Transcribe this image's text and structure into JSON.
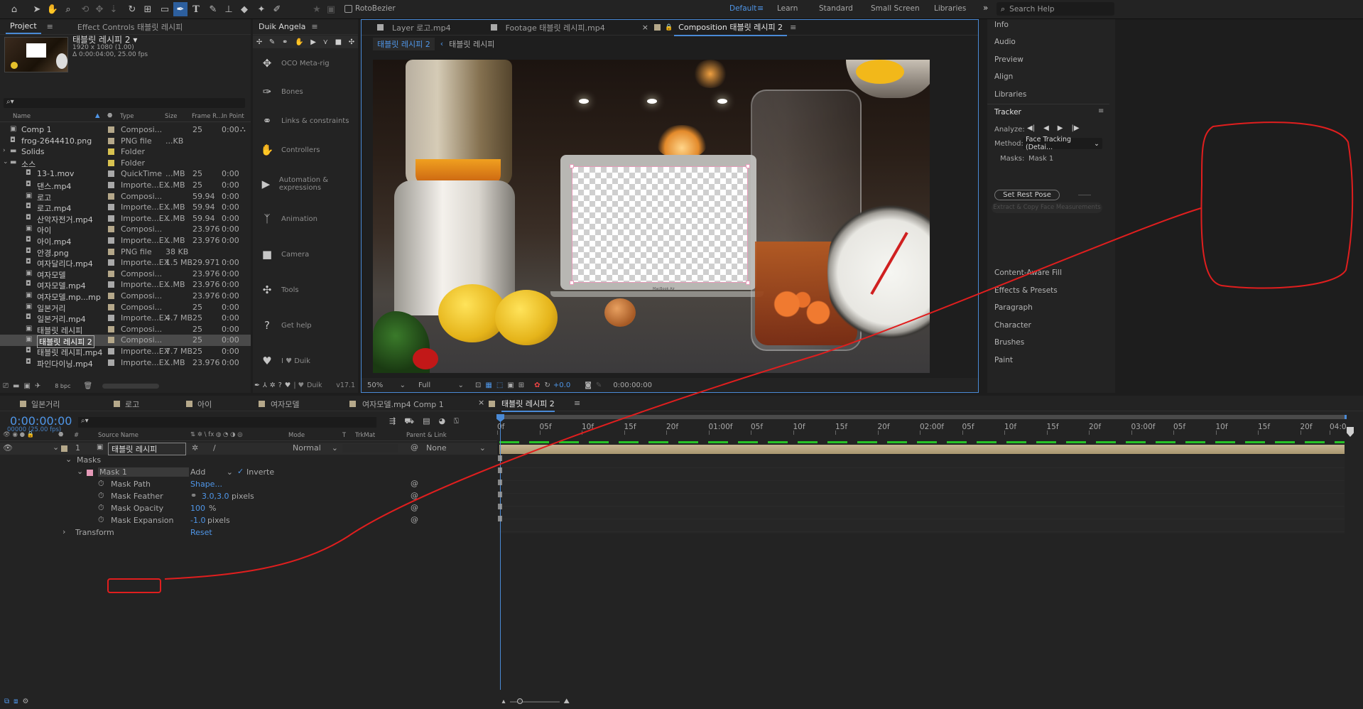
{
  "toolbar": {
    "rotobezier_label": "RotoBezier",
    "workspaces": [
      "Default",
      "Learn",
      "Standard",
      "Small Screen",
      "Libraries"
    ],
    "active_workspace": "Default",
    "search_placeholder": "Search Help"
  },
  "project_panel": {
    "tabs": [
      "Project",
      "Effect Controls 태블릿 레시피"
    ],
    "selected_name": "태블릿 레시피 2 ▾",
    "selected_res": "1920 x 1080 (1.00)",
    "selected_duration": "Δ 0:00:04:00, 25.00 fps",
    "columns": [
      "Name",
      "Type",
      "Size",
      "Frame R...",
      "In Point"
    ],
    "items": [
      {
        "name": "Comp 1",
        "type": "Composi...",
        "size": "",
        "fps": "25",
        "in": "0:00",
        "color": "#b5a88a",
        "indent": 0
      },
      {
        "name": "frog-2644410.png",
        "type": "PNG file",
        "size": "...KB",
        "fps": "",
        "in": "",
        "color": "#b5a88a",
        "indent": 0
      },
      {
        "name": "Solids",
        "type": "Folder",
        "size": "",
        "fps": "",
        "in": "",
        "color": "#d8c250",
        "indent": 0
      },
      {
        "name": "소스",
        "type": "Folder",
        "size": "",
        "fps": "",
        "in": "",
        "color": "#d8c250",
        "indent": 0
      },
      {
        "name": "13-1.mov",
        "type": "QuickTime",
        "size": "...MB",
        "fps": "25",
        "in": "0:00",
        "color": "#a9a9a9",
        "indent": 1
      },
      {
        "name": "댄스.mp4",
        "type": "Importe...EX",
        "size": "...MB",
        "fps": "25",
        "in": "0:00",
        "color": "#a9a9a9",
        "indent": 1
      },
      {
        "name": "로고",
        "type": "Composi...",
        "size": "",
        "fps": "59.94",
        "in": "0:00",
        "color": "#b5a88a",
        "indent": 1
      },
      {
        "name": "로고.mp4",
        "type": "Importe...EX",
        "size": "...MB",
        "fps": "59.94",
        "in": "0:00",
        "color": "#a9a9a9",
        "indent": 1
      },
      {
        "name": "산악자전거.mp4",
        "type": "Importe...EX",
        "size": "...MB",
        "fps": "59.94",
        "in": "0:00",
        "color": "#a9a9a9",
        "indent": 1
      },
      {
        "name": "아이",
        "type": "Composi...",
        "size": "",
        "fps": "23.976",
        "in": "0:00",
        "color": "#b5a88a",
        "indent": 1
      },
      {
        "name": "아이.mp4",
        "type": "Importe...EX",
        "size": "...MB",
        "fps": "23.976",
        "in": "0:00",
        "color": "#a9a9a9",
        "indent": 1
      },
      {
        "name": "안경.png",
        "type": "PNG file",
        "size": "38 KB",
        "fps": "",
        "in": "",
        "color": "#b5a88a",
        "indent": 1
      },
      {
        "name": "여자달리다.mp4",
        "type": "Importe...EX",
        "size": "1.5 MB",
        "fps": "29.971",
        "in": "0:00",
        "color": "#a9a9a9",
        "indent": 1
      },
      {
        "name": "여자모델",
        "type": "Composi...",
        "size": "",
        "fps": "23.976",
        "in": "0:00",
        "color": "#b5a88a",
        "indent": 1
      },
      {
        "name": "여자모델.mp4",
        "type": "Importe...EX",
        "size": "...MB",
        "fps": "23.976",
        "in": "0:00",
        "color": "#a9a9a9",
        "indent": 1
      },
      {
        "name": "여자모델.mp...mp 1",
        "type": "Composi...",
        "size": "",
        "fps": "23.976",
        "in": "0:00",
        "color": "#b5a88a",
        "indent": 1
      },
      {
        "name": "일본거리",
        "type": "Composi...",
        "size": "",
        "fps": "25",
        "in": "0:00",
        "color": "#b5a88a",
        "indent": 1
      },
      {
        "name": "일본거리.mp4",
        "type": "Importe...EX",
        "size": "4.7 MB",
        "fps": "25",
        "in": "0:00",
        "color": "#a9a9a9",
        "indent": 1
      },
      {
        "name": "태블릿 레시피",
        "type": "Composi...",
        "size": "",
        "fps": "25",
        "in": "0:00",
        "color": "#b5a88a",
        "indent": 1
      },
      {
        "name": "태블릿 레시피 2",
        "type": "Composi...",
        "size": "",
        "fps": "25",
        "in": "0:00",
        "color": "#b5a88a",
        "indent": 1,
        "selected": true
      },
      {
        "name": "태블릿 레시피.mp4",
        "type": "Importe...EX",
        "size": "7.7 MB",
        "fps": "25",
        "in": "0:00",
        "color": "#a9a9a9",
        "indent": 1
      },
      {
        "name": "파인다이닝.mp4",
        "type": "Importe...EX",
        "size": "...MB",
        "fps": "23.976",
        "in": "0:00",
        "color": "#a9a9a9",
        "indent": 1
      }
    ],
    "bpc": "8 bpc"
  },
  "duik": {
    "title": "Duik Angela",
    "items": [
      "OCO Meta-rig",
      "Bones",
      "Links & constraints",
      "Controllers",
      "Automation & expressions",
      "Animation",
      "Camera",
      "Tools",
      "Get help",
      "I ♥ Duik"
    ],
    "footer_duik": "Duik",
    "version": "v17.1"
  },
  "viewer": {
    "tabs": [
      "Layer 로고.mp4",
      "Footage 태블릿 레시피.mp4",
      "Composition 태블릿 레시피 2"
    ],
    "breadcrumbs": [
      "태블릿 레시피 2",
      "태블릿 레시피"
    ],
    "zoom": "50%",
    "resolution": "Full",
    "exposure": "+0.0",
    "timecode": "0:00:00:00",
    "macbook_label": "MacBook Air"
  },
  "right_panels": {
    "top": [
      "Info",
      "Audio",
      "Preview",
      "Align",
      "Libraries"
    ],
    "tracker": {
      "title": "Tracker",
      "analyze_label": "Analyze:",
      "method_label": "Method:",
      "method_value": "Face Tracking (Detai...",
      "masks_label": "Masks:",
      "masks_value": "Mask 1",
      "set_rest_pose": "Set Rest Pose",
      "extract": "Extract & Copy Face Measurements"
    },
    "bottom": [
      "Content-Aware Fill",
      "Effects & Presets",
      "Paragraph",
      "Character",
      "Brushes",
      "Paint"
    ]
  },
  "timeline": {
    "tabs": [
      "일본거리",
      "로고",
      "아이",
      "여자모델",
      "여자모델.mp4 Comp 1",
      "태블릿 레시피 2"
    ],
    "timecode": "0:00:00:00",
    "frame_info": "00000 (25.00 fps)",
    "columns": [
      "Source Name",
      "Mode",
      "T",
      "TrkMat",
      "Parent & Link"
    ],
    "layer": {
      "num": "1",
      "name": "태블릿 레시피",
      "mode": "Normal",
      "parent": "None"
    },
    "masks_label": "Masks",
    "mask_name": "Mask 1",
    "mask_mode": "Add",
    "inverted_label": "Inverte",
    "properties": [
      {
        "label": "Mask Path",
        "value": "Shape...",
        "unit": ""
      },
      {
        "label": "Mask Feather",
        "value": "3.0,3.0",
        "unit": "pixels"
      },
      {
        "label": "Mask Opacity",
        "value": "100",
        "unit": "%"
      },
      {
        "label": "Mask Expansion",
        "value": "-1.0",
        "unit": "pixels"
      }
    ],
    "transform_label": "Transform",
    "reset_label": "Reset",
    "ruler": [
      "0f",
      "05f",
      "10f",
      "15f",
      "20f",
      "01:00f",
      "05f",
      "10f",
      "15f",
      "20f",
      "02:00f",
      "05f",
      "10f",
      "15f",
      "20f",
      "03:00f",
      "05f",
      "10f",
      "15f",
      "20f",
      "04:0"
    ]
  },
  "colors": {
    "accent": "#4a8ad6",
    "annotation": "#e01e1e",
    "layer_bar": "#b8a584",
    "cache_bar": "#28c228"
  }
}
